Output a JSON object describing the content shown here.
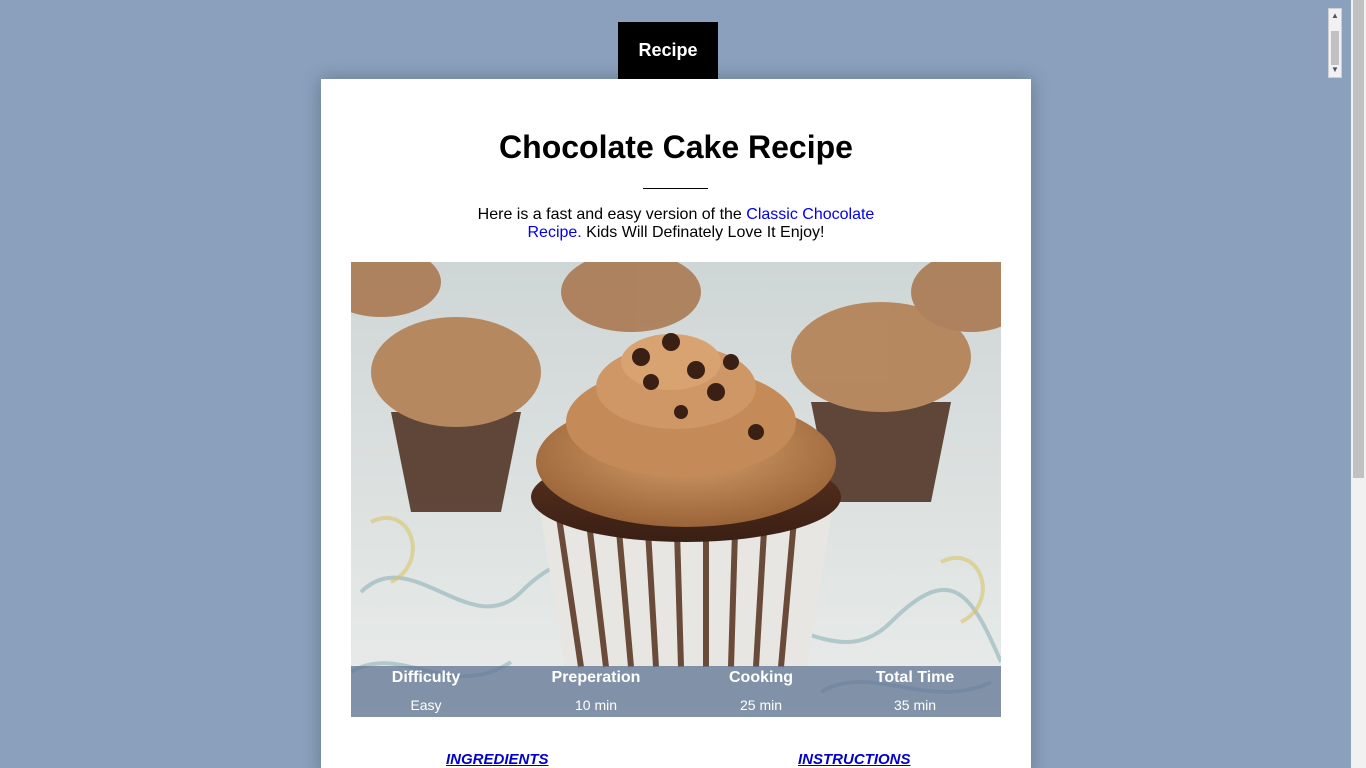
{
  "tab": {
    "label": "Recipe"
  },
  "recipe": {
    "title": "Chocolate Cake Recipe",
    "intro_before": "Here is a fast and easy version of the ",
    "intro_link": "Classic Chocolate Recipe.",
    "intro_after": " Kids Will Definately Love It Enjoy!"
  },
  "stats": [
    {
      "label": "Difficulty",
      "value": "Easy"
    },
    {
      "label": "Preperation",
      "value": "10 min"
    },
    {
      "label": "Cooking",
      "value": "25 min"
    },
    {
      "label": "Total Time",
      "value": "35 min"
    }
  ],
  "sections": {
    "ingredients": "INGREDIENTS",
    "instructions": "INSTRUCTIONS"
  },
  "colors": {
    "background": "#8aa0bd",
    "tab": "#000000",
    "link": "#0000ee",
    "section_heading": "#0000cc"
  }
}
